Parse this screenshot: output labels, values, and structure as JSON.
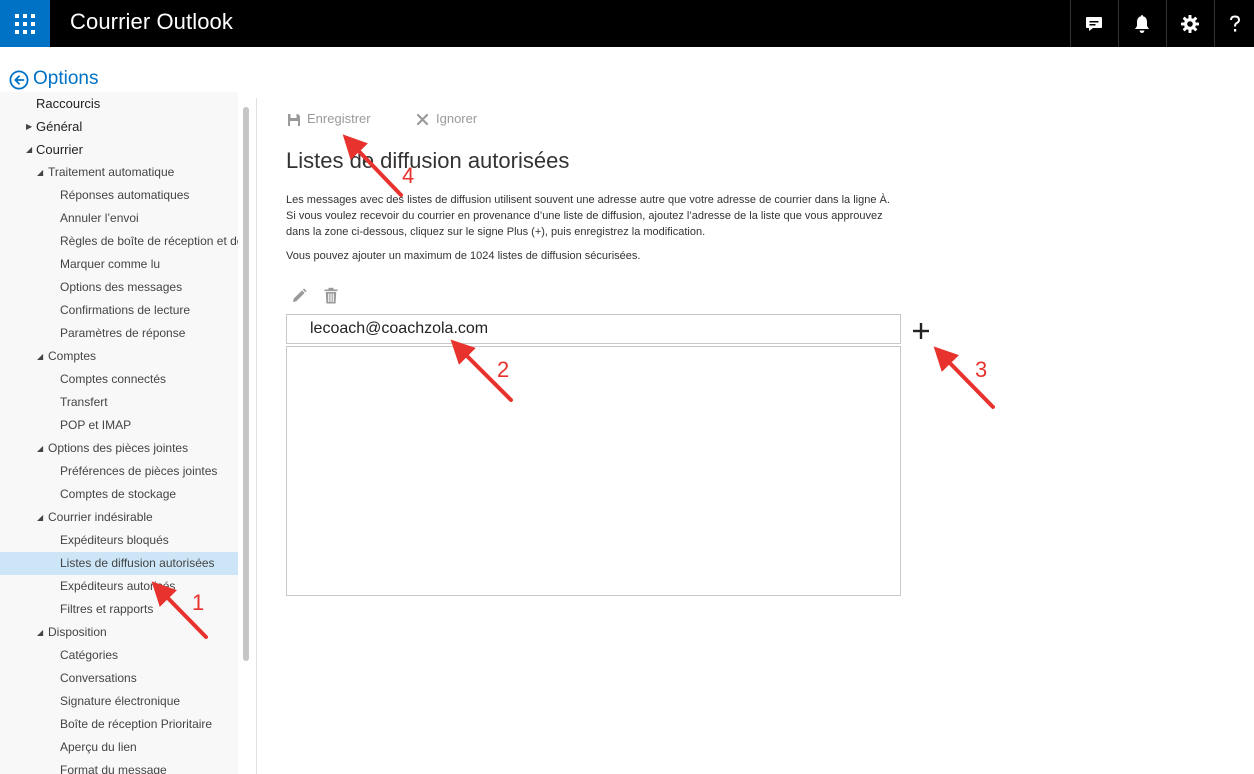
{
  "topbar": {
    "title": "Courrier Outlook",
    "icons": [
      "app-launcher-icon",
      "chat-feedback-icon",
      "bell-icon",
      "gear-icon",
      "help-icon"
    ]
  },
  "options": {
    "title": "Options"
  },
  "sidebar": {
    "items": [
      {
        "label": "Raccourcis"
      },
      {
        "label": "Général"
      },
      {
        "label": "Courrier"
      },
      {
        "label": "Traitement automatique"
      },
      {
        "label": "Réponses automatiques"
      },
      {
        "label": "Annuler l’envoi"
      },
      {
        "label": "Règles de boîte de réception et de"
      },
      {
        "label": "Marquer comme lu"
      },
      {
        "label": "Options des messages"
      },
      {
        "label": "Confirmations de lecture"
      },
      {
        "label": "Paramètres de réponse"
      },
      {
        "label": "Comptes"
      },
      {
        "label": "Comptes connectés"
      },
      {
        "label": "Transfert"
      },
      {
        "label": "POP et IMAP"
      },
      {
        "label": "Options des pièces jointes"
      },
      {
        "label": "Préférences de pièces jointes"
      },
      {
        "label": "Comptes de stockage"
      },
      {
        "label": "Courrier indésirable"
      },
      {
        "label": "Expéditeurs bloqués"
      },
      {
        "label": "Listes de diffusion autorisées"
      },
      {
        "label": "Expéditeurs autorisés"
      },
      {
        "label": "Filtres et rapports"
      },
      {
        "label": "Disposition"
      },
      {
        "label": "Catégories"
      },
      {
        "label": "Conversations"
      },
      {
        "label": "Signature électronique"
      },
      {
        "label": "Boîte de réception Prioritaire"
      },
      {
        "label": "Aperçu du lien"
      },
      {
        "label": "Format du message"
      }
    ]
  },
  "toolbar": {
    "save_label": "Enregistrer",
    "ignore_label": "Ignorer"
  },
  "main": {
    "title": "Listes de diffusion autorisées",
    "description_lines": [
      "Les messages avec des listes de diffusion utilisent souvent une adresse autre que votre adresse de courrier dans la ligne À.",
      "Si vous voulez recevoir du courrier en provenance d’une liste de diffusion, ajoutez l’adresse de la liste que vous approuvez",
      "dans la zone ci-dessous, cliquez sur le signe Plus (+), puis enregistrez la modification."
    ],
    "max_note": "Vous pouvez ajouter un maximum de 1024 listes de diffusion sécurisées.",
    "address_value": "lecoach@coachzola.com",
    "add_label": "+"
  },
  "annotations": {
    "numbers": [
      "1",
      "2",
      "3",
      "4"
    ],
    "color": "#e8322d"
  },
  "colors": {
    "accent": "#0072c6",
    "topbar": "#000000",
    "selected": "#cde6f7"
  }
}
